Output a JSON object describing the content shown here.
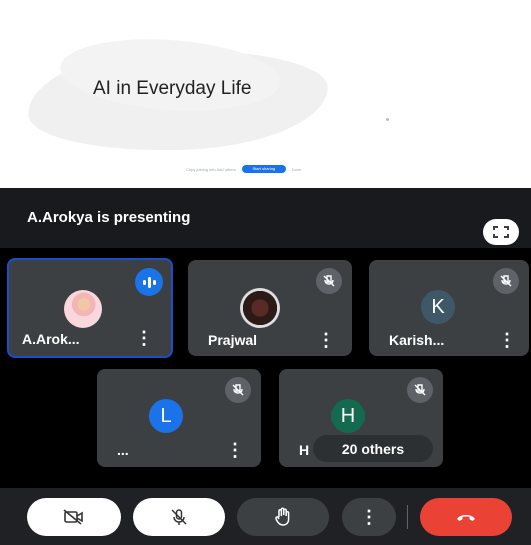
{
  "slide": {
    "title": "AI in Everyday Life",
    "toolbar_text": "Copy joining info  Add others",
    "toolbar_button": "Start sharing",
    "toolbar_after": "Done"
  },
  "meet": {
    "presenting_text": "A.Arokya is presenting",
    "participants": [
      {
        "name": "A.Arok...",
        "avatar": "photo",
        "speaking": true
      },
      {
        "name": "Prajwal",
        "avatar": "photo",
        "muted": true
      },
      {
        "name": "Karish...",
        "initial": "K",
        "avatar_color": "#3e5868",
        "muted": true
      },
      {
        "name": "...",
        "initial": "L",
        "avatar_color": "#1a73e8",
        "muted": true
      },
      {
        "name": "H",
        "initial": "H",
        "avatar_color": "#136a4e",
        "muted": true
      }
    ],
    "others_label": "20 others"
  },
  "controls": {
    "camera": "camera-off-icon",
    "mic": "mic-off-icon",
    "hand": "raise-hand-icon",
    "more": "more-options-icon",
    "end": "end-call-icon",
    "end_color": "#ea4335"
  }
}
